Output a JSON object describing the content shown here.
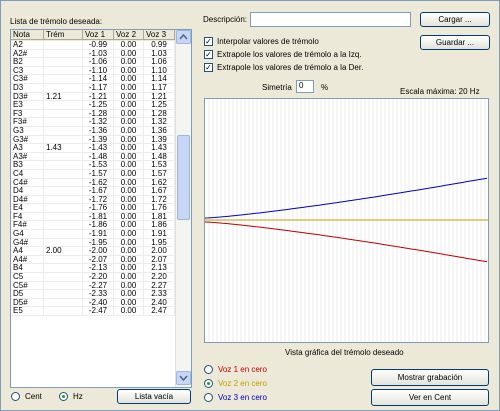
{
  "left": {
    "list_label": "Lista de trémolo deseada:",
    "columns": [
      "Nota",
      "Trém",
      "Voz 1",
      "Voz 2",
      "Voz 3"
    ],
    "rows": [
      [
        "A2",
        "",
        "-0.99",
        "0.00",
        "0.99"
      ],
      [
        "A2#",
        "",
        "-1.03",
        "0.00",
        "1.03"
      ],
      [
        "B2",
        "",
        "-1.06",
        "0.00",
        "1.06"
      ],
      [
        "C3",
        "",
        "-1.10",
        "0.00",
        "1.10"
      ],
      [
        "C3#",
        "",
        "-1.14",
        "0.00",
        "1.14"
      ],
      [
        "D3",
        "",
        "-1.17",
        "0.00",
        "1.17"
      ],
      [
        "D3#",
        "1.21",
        "-1.21",
        "0.00",
        "1.21"
      ],
      [
        "E3",
        "",
        "-1.25",
        "0.00",
        "1.25"
      ],
      [
        "F3",
        "",
        "-1.28",
        "0.00",
        "1.28"
      ],
      [
        "F3#",
        "",
        "-1.32",
        "0.00",
        "1.32"
      ],
      [
        "G3",
        "",
        "-1.36",
        "0.00",
        "1.36"
      ],
      [
        "G3#",
        "",
        "-1.39",
        "0.00",
        "1.39"
      ],
      [
        "A3",
        "1.43",
        "-1.43",
        "0.00",
        "1.43"
      ],
      [
        "A3#",
        "",
        "-1.48",
        "0.00",
        "1.48"
      ],
      [
        "B3",
        "",
        "-1.53",
        "0.00",
        "1.53"
      ],
      [
        "C4",
        "",
        "-1.57",
        "0.00",
        "1.57"
      ],
      [
        "C4#",
        "",
        "-1.62",
        "0.00",
        "1.62"
      ],
      [
        "D4",
        "",
        "-1.67",
        "0.00",
        "1.67"
      ],
      [
        "D4#",
        "",
        "-1.72",
        "0.00",
        "1.72"
      ],
      [
        "E4",
        "",
        "-1.76",
        "0.00",
        "1.76"
      ],
      [
        "F4",
        "",
        "-1.81",
        "0.00",
        "1.81"
      ],
      [
        "F4#",
        "",
        "-1.86",
        "0.00",
        "1.86"
      ],
      [
        "G4",
        "",
        "-1.91",
        "0.00",
        "1.91"
      ],
      [
        "G4#",
        "",
        "-1.95",
        "0.00",
        "1.95"
      ],
      [
        "A4",
        "2.00",
        "-2.00",
        "0.00",
        "2.00"
      ],
      [
        "A4#",
        "",
        "-2.07",
        "0.00",
        "2.07"
      ],
      [
        "B4",
        "",
        "-2.13",
        "0.00",
        "2.13"
      ],
      [
        "C5",
        "",
        "-2.20",
        "0.00",
        "2.20"
      ],
      [
        "C5#",
        "",
        "-2.27",
        "0.00",
        "2.27"
      ],
      [
        "D5",
        "",
        "-2.33",
        "0.00",
        "2.33"
      ],
      [
        "D5#",
        "",
        "-2.40",
        "0.00",
        "2.40"
      ],
      [
        "E5",
        "",
        "-2.47",
        "0.00",
        "2.47"
      ]
    ],
    "radio_cent": "Cent",
    "radio_hz": "Hz",
    "clear_button": "Lista vacía"
  },
  "right": {
    "description_label": "Descripción:",
    "description_value": "",
    "load_button": "Cargar ...",
    "save_button": "Guardar ...",
    "cb_interpolate": "Interpolar valores de trémolo",
    "cb_extrap_left": "Extrapole los valores de trémolo a la Izq.",
    "cb_extrap_right": "Extrapole los valores de trémolo a la Der.",
    "symmetry_label": "Simetría",
    "symmetry_value": "0",
    "symmetry_unit": "%",
    "max_scale": "Escala máxima: 20 Hz",
    "graph_caption": "Vista gráfica del trémolo deseado",
    "radio_voice1": "Voz 1 en cero",
    "radio_voice2": "Voz 2 en cero",
    "radio_voice3": "Voz 3 en cero",
    "show_recording_button": "Mostrar grabación",
    "view_cent_button": "Ver en Cent"
  },
  "colors": {
    "voice1": "#c00000",
    "voice2": "#c0a000",
    "voice3": "#0000c0"
  }
}
